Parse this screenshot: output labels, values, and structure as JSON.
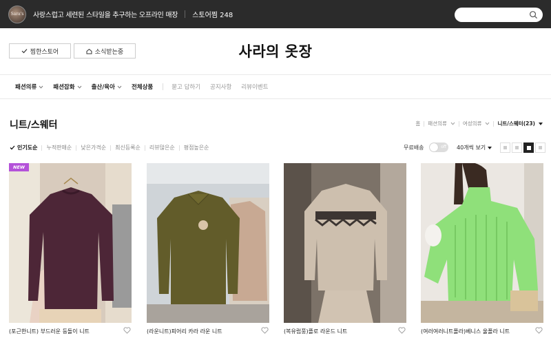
{
  "topbar": {
    "avatar_text": "Sara's",
    "tagline": "사랑스럽고 세련된 스타일을 추구하는 오프라인 매장",
    "storepick": "스토어찜 248",
    "search_placeholder": ""
  },
  "store": {
    "title": "사라의 옷장",
    "follow_label": "찜한스토어",
    "news_label": "소식받는중"
  },
  "nav": {
    "items": [
      {
        "label": "패션의류",
        "dropdown": true
      },
      {
        "label": "패션잡화",
        "dropdown": true
      },
      {
        "label": "출산/육아",
        "dropdown": true
      },
      {
        "label": "전체상품",
        "dropdown": false
      }
    ],
    "links": [
      "묻고 답하기",
      "공지사항",
      "리뷰이벤트"
    ]
  },
  "category": {
    "title": "니트/스웨터",
    "breadcrumb": [
      "홈",
      "패션의류",
      "여성의류",
      "니트/스웨터(23)"
    ]
  },
  "sort": {
    "options": [
      "인기도순",
      "누적판매순",
      "낮은가격순",
      "최신등록순",
      "리뷰많은순",
      "평점높은순"
    ],
    "active_index": 0,
    "free_shipping_label": "무료배송",
    "toggle_label": "off",
    "per_page": "40개씩 보기"
  },
  "products": [
    {
      "name": "(포근한니트) 부드러운 둥돌이 니트",
      "badge": "NEW"
    },
    {
      "name": "(라운니트)피어리 카라 라운 니트",
      "badge": ""
    },
    {
      "name": "(복유럽풍)플로 라운드 니트",
      "badge": ""
    },
    {
      "name": "(여러여러니트폴라)베니스 울폴라 니트",
      "badge": ""
    }
  ],
  "colors": {
    "topbar_bg": "#2b2b2b",
    "badge_new": "#b452d9"
  }
}
